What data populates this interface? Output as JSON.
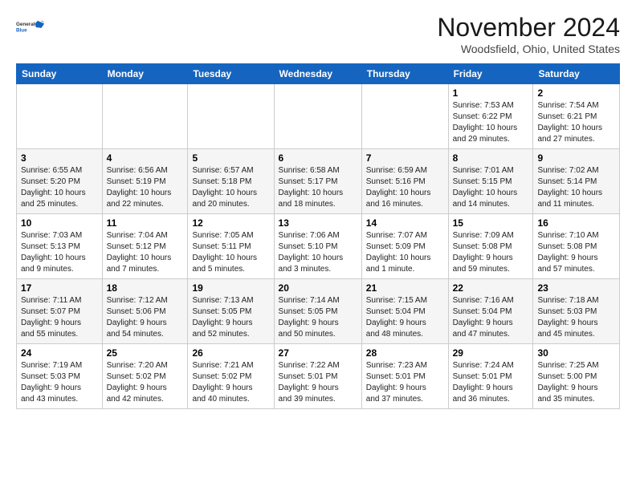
{
  "logo": {
    "line1": "General",
    "line2": "Blue"
  },
  "title": "November 2024",
  "location": "Woodsfield, Ohio, United States",
  "headers": [
    "Sunday",
    "Monday",
    "Tuesday",
    "Wednesday",
    "Thursday",
    "Friday",
    "Saturday"
  ],
  "weeks": [
    [
      {
        "day": "",
        "info": ""
      },
      {
        "day": "",
        "info": ""
      },
      {
        "day": "",
        "info": ""
      },
      {
        "day": "",
        "info": ""
      },
      {
        "day": "",
        "info": ""
      },
      {
        "day": "1",
        "info": "Sunrise: 7:53 AM\nSunset: 6:22 PM\nDaylight: 10 hours\nand 29 minutes."
      },
      {
        "day": "2",
        "info": "Sunrise: 7:54 AM\nSunset: 6:21 PM\nDaylight: 10 hours\nand 27 minutes."
      }
    ],
    [
      {
        "day": "3",
        "info": "Sunrise: 6:55 AM\nSunset: 5:20 PM\nDaylight: 10 hours\nand 25 minutes."
      },
      {
        "day": "4",
        "info": "Sunrise: 6:56 AM\nSunset: 5:19 PM\nDaylight: 10 hours\nand 22 minutes."
      },
      {
        "day": "5",
        "info": "Sunrise: 6:57 AM\nSunset: 5:18 PM\nDaylight: 10 hours\nand 20 minutes."
      },
      {
        "day": "6",
        "info": "Sunrise: 6:58 AM\nSunset: 5:17 PM\nDaylight: 10 hours\nand 18 minutes."
      },
      {
        "day": "7",
        "info": "Sunrise: 6:59 AM\nSunset: 5:16 PM\nDaylight: 10 hours\nand 16 minutes."
      },
      {
        "day": "8",
        "info": "Sunrise: 7:01 AM\nSunset: 5:15 PM\nDaylight: 10 hours\nand 14 minutes."
      },
      {
        "day": "9",
        "info": "Sunrise: 7:02 AM\nSunset: 5:14 PM\nDaylight: 10 hours\nand 11 minutes."
      }
    ],
    [
      {
        "day": "10",
        "info": "Sunrise: 7:03 AM\nSunset: 5:13 PM\nDaylight: 10 hours\nand 9 minutes."
      },
      {
        "day": "11",
        "info": "Sunrise: 7:04 AM\nSunset: 5:12 PM\nDaylight: 10 hours\nand 7 minutes."
      },
      {
        "day": "12",
        "info": "Sunrise: 7:05 AM\nSunset: 5:11 PM\nDaylight: 10 hours\nand 5 minutes."
      },
      {
        "day": "13",
        "info": "Sunrise: 7:06 AM\nSunset: 5:10 PM\nDaylight: 10 hours\nand 3 minutes."
      },
      {
        "day": "14",
        "info": "Sunrise: 7:07 AM\nSunset: 5:09 PM\nDaylight: 10 hours\nand 1 minute."
      },
      {
        "day": "15",
        "info": "Sunrise: 7:09 AM\nSunset: 5:08 PM\nDaylight: 9 hours\nand 59 minutes."
      },
      {
        "day": "16",
        "info": "Sunrise: 7:10 AM\nSunset: 5:08 PM\nDaylight: 9 hours\nand 57 minutes."
      }
    ],
    [
      {
        "day": "17",
        "info": "Sunrise: 7:11 AM\nSunset: 5:07 PM\nDaylight: 9 hours\nand 55 minutes."
      },
      {
        "day": "18",
        "info": "Sunrise: 7:12 AM\nSunset: 5:06 PM\nDaylight: 9 hours\nand 54 minutes."
      },
      {
        "day": "19",
        "info": "Sunrise: 7:13 AM\nSunset: 5:05 PM\nDaylight: 9 hours\nand 52 minutes."
      },
      {
        "day": "20",
        "info": "Sunrise: 7:14 AM\nSunset: 5:05 PM\nDaylight: 9 hours\nand 50 minutes."
      },
      {
        "day": "21",
        "info": "Sunrise: 7:15 AM\nSunset: 5:04 PM\nDaylight: 9 hours\nand 48 minutes."
      },
      {
        "day": "22",
        "info": "Sunrise: 7:16 AM\nSunset: 5:04 PM\nDaylight: 9 hours\nand 47 minutes."
      },
      {
        "day": "23",
        "info": "Sunrise: 7:18 AM\nSunset: 5:03 PM\nDaylight: 9 hours\nand 45 minutes."
      }
    ],
    [
      {
        "day": "24",
        "info": "Sunrise: 7:19 AM\nSunset: 5:03 PM\nDaylight: 9 hours\nand 43 minutes."
      },
      {
        "day": "25",
        "info": "Sunrise: 7:20 AM\nSunset: 5:02 PM\nDaylight: 9 hours\nand 42 minutes."
      },
      {
        "day": "26",
        "info": "Sunrise: 7:21 AM\nSunset: 5:02 PM\nDaylight: 9 hours\nand 40 minutes."
      },
      {
        "day": "27",
        "info": "Sunrise: 7:22 AM\nSunset: 5:01 PM\nDaylight: 9 hours\nand 39 minutes."
      },
      {
        "day": "28",
        "info": "Sunrise: 7:23 AM\nSunset: 5:01 PM\nDaylight: 9 hours\nand 37 minutes."
      },
      {
        "day": "29",
        "info": "Sunrise: 7:24 AM\nSunset: 5:01 PM\nDaylight: 9 hours\nand 36 minutes."
      },
      {
        "day": "30",
        "info": "Sunrise: 7:25 AM\nSunset: 5:00 PM\nDaylight: 9 hours\nand 35 minutes."
      }
    ]
  ]
}
